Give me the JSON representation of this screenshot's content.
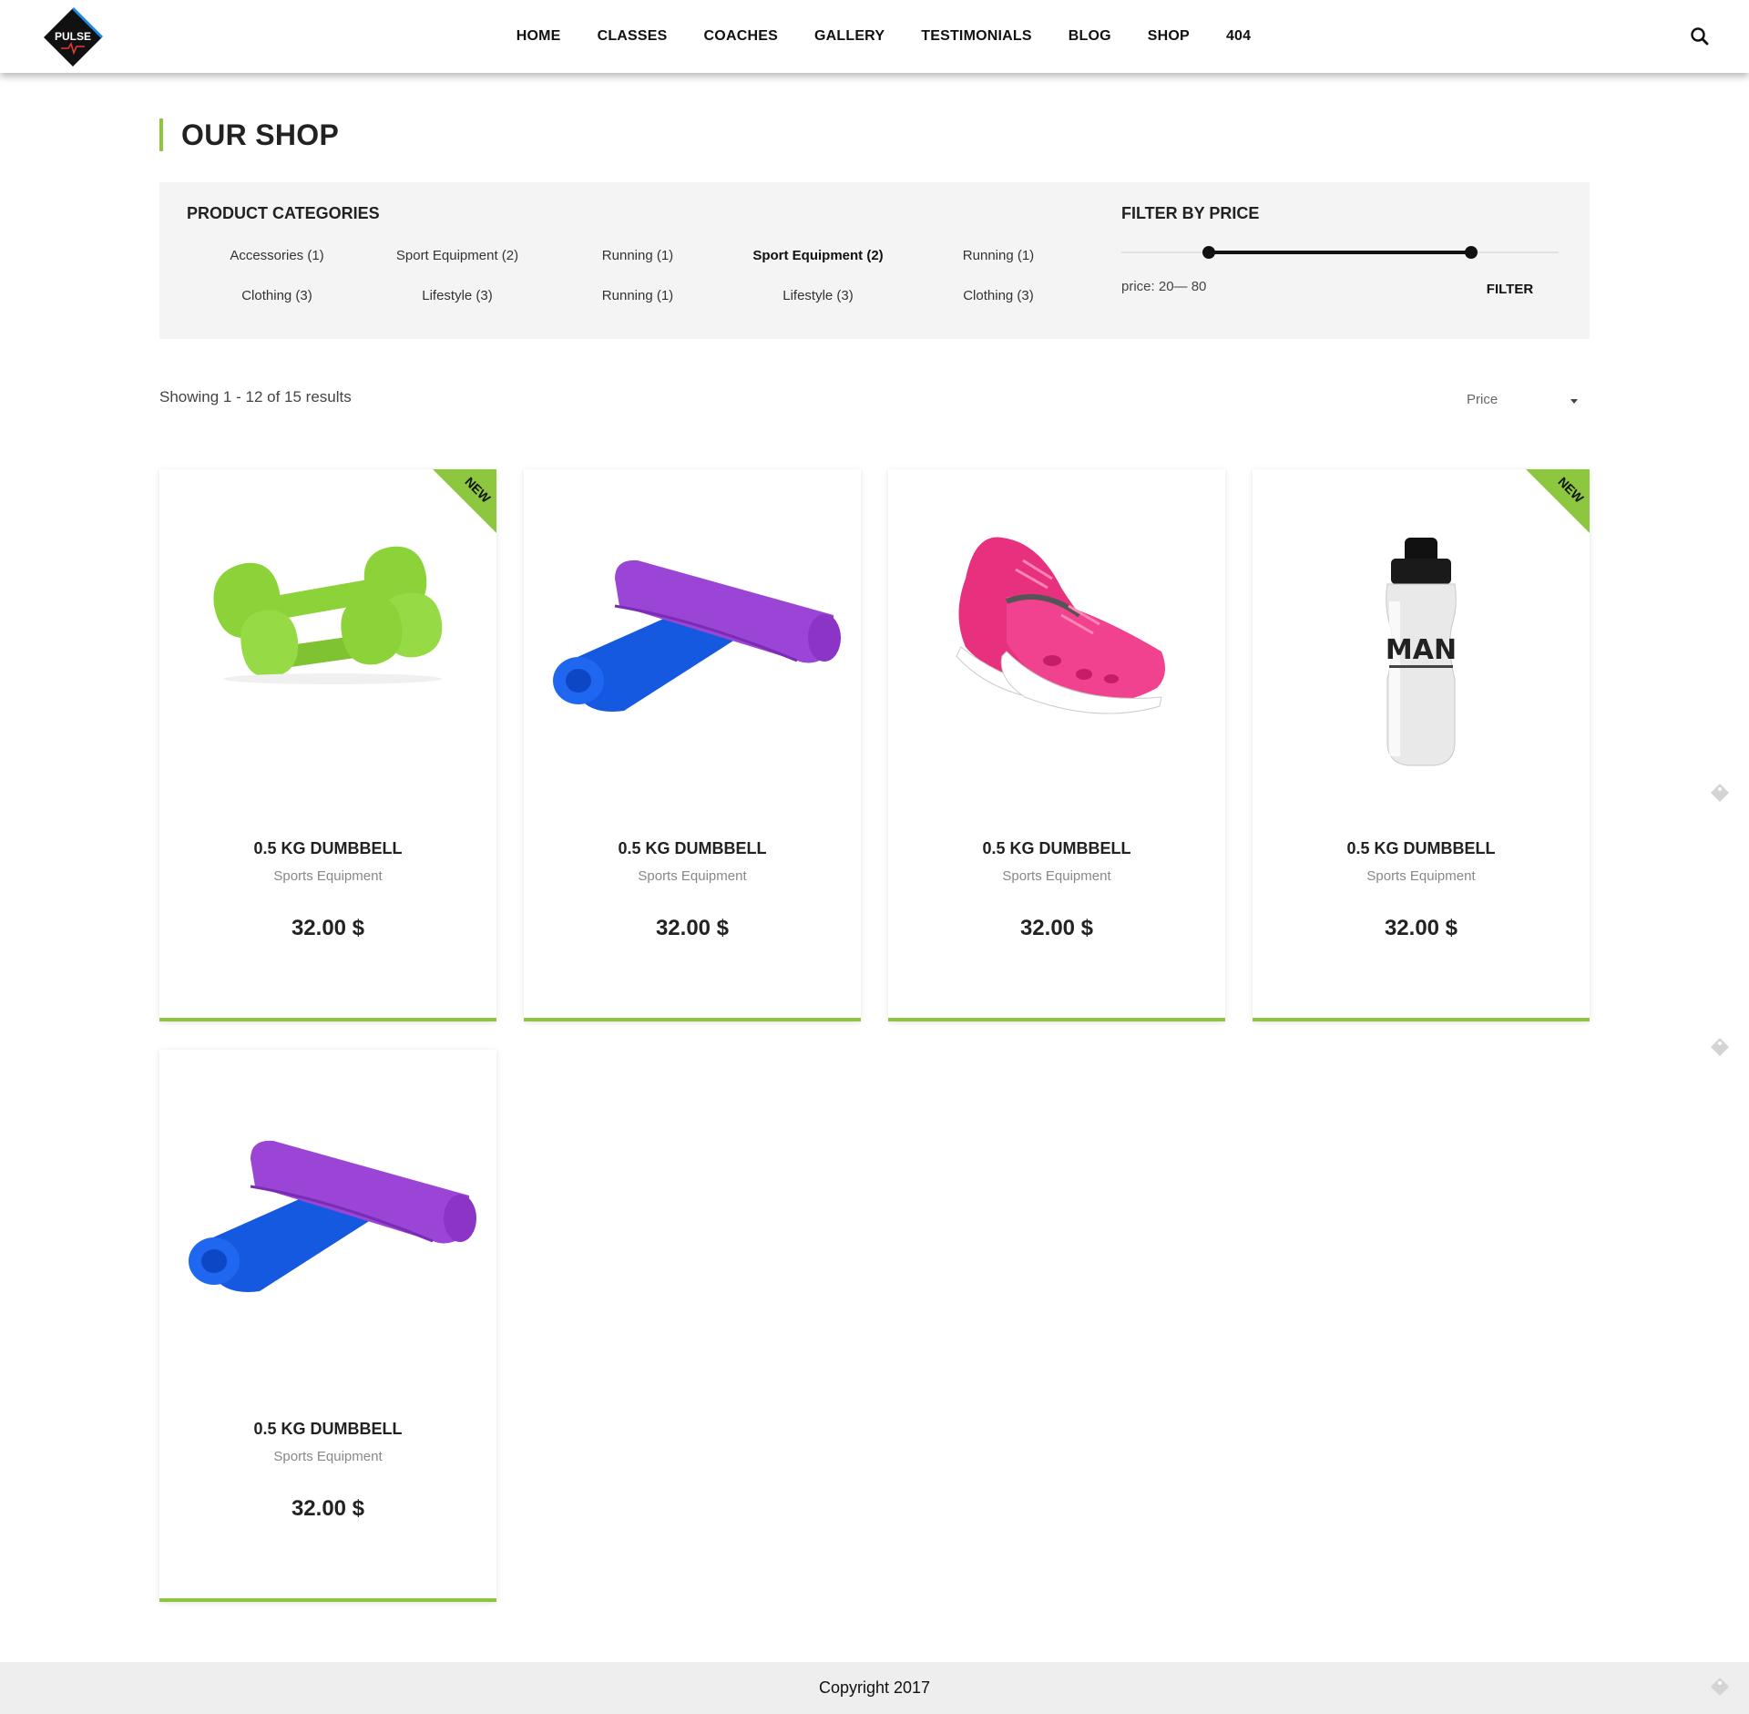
{
  "brand": {
    "logo_text": "PULSE"
  },
  "nav": {
    "items": [
      "HOME",
      "CLASSES",
      "COACHES",
      "GALLERY",
      "TESTIMONIALS",
      "BLOG",
      "SHOP",
      "404"
    ],
    "search_icon": "search-icon"
  },
  "page": {
    "title": "OUR SHOP"
  },
  "categories": {
    "title": "PRODUCT CATEGORIES",
    "items": [
      {
        "label": "Accessories (1)",
        "active": false
      },
      {
        "label": "Sport Equipment (2)",
        "active": false
      },
      {
        "label": "Running (1)",
        "active": false
      },
      {
        "label": "Sport Equipment (2)",
        "active": true
      },
      {
        "label": "Running (1)",
        "active": false
      },
      {
        "label": "Clothing (3)",
        "active": false
      },
      {
        "label": "Lifestyle (3)",
        "active": false
      },
      {
        "label": "Running (1)",
        "active": false
      },
      {
        "label": "Lifestyle (3)",
        "active": false
      },
      {
        "label": "Clothing (3)",
        "active": false
      }
    ]
  },
  "price_filter": {
    "title": "FILTER BY PRICE",
    "label": "price: 20— 80",
    "min": 20,
    "max": 80,
    "range_start_fraction": 0.2,
    "range_end_fraction": 0.8,
    "button": "FILTER"
  },
  "results": {
    "count_text": "Showing 1 - 12 of 15 results",
    "sort_selected": "Price"
  },
  "products": [
    {
      "name": "0.5 KG DUMBBELL",
      "category": "Sports Equipment",
      "price": "32.00 $",
      "badge": "NEW",
      "image": "dumbbells"
    },
    {
      "name": "0.5 KG DUMBBELL",
      "category": "Sports Equipment",
      "price": "32.00 $",
      "badge": "",
      "image": "yoga-mats"
    },
    {
      "name": "0.5 KG DUMBBELL",
      "category": "Sports Equipment",
      "price": "32.00 $",
      "badge": "",
      "image": "sneakers"
    },
    {
      "name": "0.5 KG DUMBBELL",
      "category": "Sports Equipment",
      "price": "32.00 $",
      "badge": "NEW",
      "image": "water-bottle",
      "image_text": "MAN"
    },
    {
      "name": "0.5 KG DUMBBELL",
      "category": "Sports Equipment",
      "price": "32.00 $",
      "badge": "",
      "image": "yoga-mats"
    }
  ],
  "footer": {
    "copyright": "Copyright 2017"
  },
  "colors": {
    "accent": "#8dc63f",
    "panel": "#f4f4f4",
    "text": "#222222"
  }
}
